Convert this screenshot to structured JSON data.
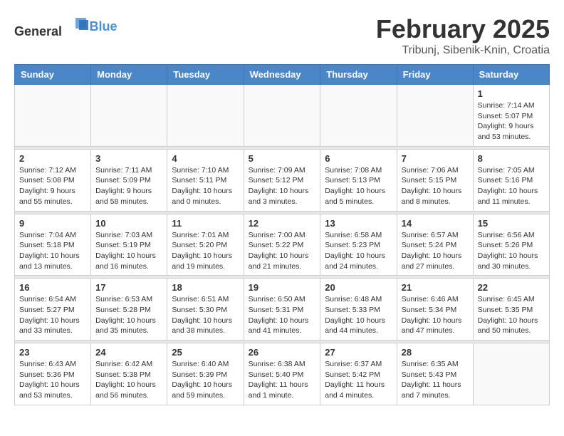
{
  "header": {
    "logo_general": "General",
    "logo_blue": "Blue",
    "main_title": "February 2025",
    "subtitle": "Tribunj, Sibenik-Knin, Croatia"
  },
  "calendar": {
    "days_of_week": [
      "Sunday",
      "Monday",
      "Tuesday",
      "Wednesday",
      "Thursday",
      "Friday",
      "Saturday"
    ],
    "weeks": [
      [
        {
          "day": "",
          "info": ""
        },
        {
          "day": "",
          "info": ""
        },
        {
          "day": "",
          "info": ""
        },
        {
          "day": "",
          "info": ""
        },
        {
          "day": "",
          "info": ""
        },
        {
          "day": "",
          "info": ""
        },
        {
          "day": "1",
          "info": "Sunrise: 7:14 AM\nSunset: 5:07 PM\nDaylight: 9 hours and 53 minutes."
        }
      ],
      [
        {
          "day": "2",
          "info": "Sunrise: 7:12 AM\nSunset: 5:08 PM\nDaylight: 9 hours and 55 minutes."
        },
        {
          "day": "3",
          "info": "Sunrise: 7:11 AM\nSunset: 5:09 PM\nDaylight: 9 hours and 58 minutes."
        },
        {
          "day": "4",
          "info": "Sunrise: 7:10 AM\nSunset: 5:11 PM\nDaylight: 10 hours and 0 minutes."
        },
        {
          "day": "5",
          "info": "Sunrise: 7:09 AM\nSunset: 5:12 PM\nDaylight: 10 hours and 3 minutes."
        },
        {
          "day": "6",
          "info": "Sunrise: 7:08 AM\nSunset: 5:13 PM\nDaylight: 10 hours and 5 minutes."
        },
        {
          "day": "7",
          "info": "Sunrise: 7:06 AM\nSunset: 5:15 PM\nDaylight: 10 hours and 8 minutes."
        },
        {
          "day": "8",
          "info": "Sunrise: 7:05 AM\nSunset: 5:16 PM\nDaylight: 10 hours and 11 minutes."
        }
      ],
      [
        {
          "day": "9",
          "info": "Sunrise: 7:04 AM\nSunset: 5:18 PM\nDaylight: 10 hours and 13 minutes."
        },
        {
          "day": "10",
          "info": "Sunrise: 7:03 AM\nSunset: 5:19 PM\nDaylight: 10 hours and 16 minutes."
        },
        {
          "day": "11",
          "info": "Sunrise: 7:01 AM\nSunset: 5:20 PM\nDaylight: 10 hours and 19 minutes."
        },
        {
          "day": "12",
          "info": "Sunrise: 7:00 AM\nSunset: 5:22 PM\nDaylight: 10 hours and 21 minutes."
        },
        {
          "day": "13",
          "info": "Sunrise: 6:58 AM\nSunset: 5:23 PM\nDaylight: 10 hours and 24 minutes."
        },
        {
          "day": "14",
          "info": "Sunrise: 6:57 AM\nSunset: 5:24 PM\nDaylight: 10 hours and 27 minutes."
        },
        {
          "day": "15",
          "info": "Sunrise: 6:56 AM\nSunset: 5:26 PM\nDaylight: 10 hours and 30 minutes."
        }
      ],
      [
        {
          "day": "16",
          "info": "Sunrise: 6:54 AM\nSunset: 5:27 PM\nDaylight: 10 hours and 33 minutes."
        },
        {
          "day": "17",
          "info": "Sunrise: 6:53 AM\nSunset: 5:28 PM\nDaylight: 10 hours and 35 minutes."
        },
        {
          "day": "18",
          "info": "Sunrise: 6:51 AM\nSunset: 5:30 PM\nDaylight: 10 hours and 38 minutes."
        },
        {
          "day": "19",
          "info": "Sunrise: 6:50 AM\nSunset: 5:31 PM\nDaylight: 10 hours and 41 minutes."
        },
        {
          "day": "20",
          "info": "Sunrise: 6:48 AM\nSunset: 5:33 PM\nDaylight: 10 hours and 44 minutes."
        },
        {
          "day": "21",
          "info": "Sunrise: 6:46 AM\nSunset: 5:34 PM\nDaylight: 10 hours and 47 minutes."
        },
        {
          "day": "22",
          "info": "Sunrise: 6:45 AM\nSunset: 5:35 PM\nDaylight: 10 hours and 50 minutes."
        }
      ],
      [
        {
          "day": "23",
          "info": "Sunrise: 6:43 AM\nSunset: 5:36 PM\nDaylight: 10 hours and 53 minutes."
        },
        {
          "day": "24",
          "info": "Sunrise: 6:42 AM\nSunset: 5:38 PM\nDaylight: 10 hours and 56 minutes."
        },
        {
          "day": "25",
          "info": "Sunrise: 6:40 AM\nSunset: 5:39 PM\nDaylight: 10 hours and 59 minutes."
        },
        {
          "day": "26",
          "info": "Sunrise: 6:38 AM\nSunset: 5:40 PM\nDaylight: 11 hours and 1 minute."
        },
        {
          "day": "27",
          "info": "Sunrise: 6:37 AM\nSunset: 5:42 PM\nDaylight: 11 hours and 4 minutes."
        },
        {
          "day": "28",
          "info": "Sunrise: 6:35 AM\nSunset: 5:43 PM\nDaylight: 11 hours and 7 minutes."
        },
        {
          "day": "",
          "info": ""
        }
      ]
    ]
  }
}
